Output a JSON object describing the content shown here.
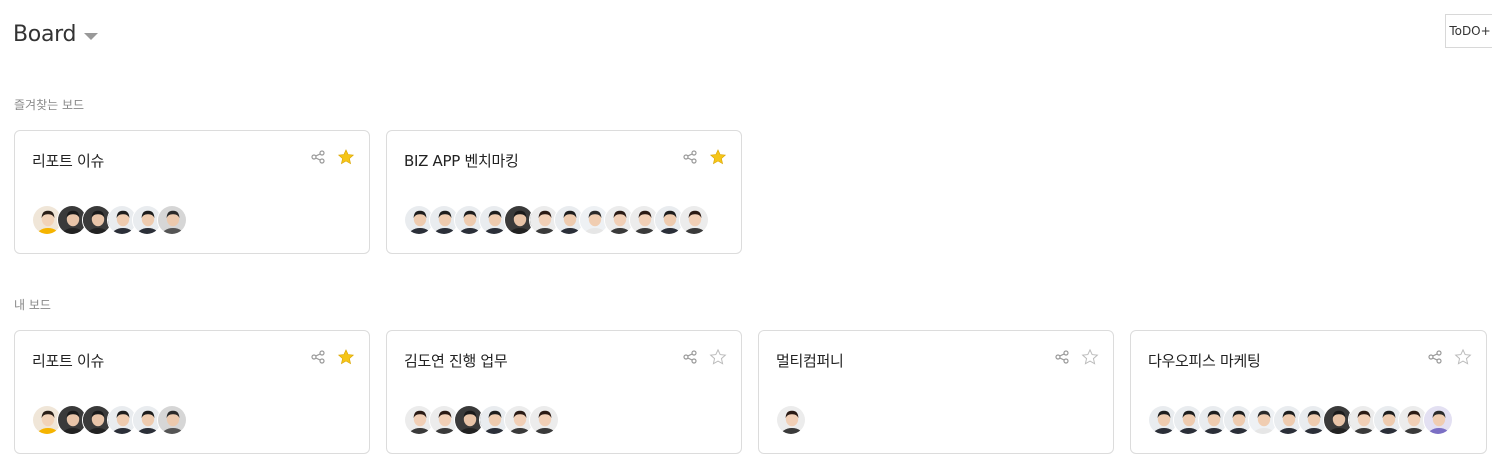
{
  "header": {
    "title": "Board",
    "todo_label": "ToDO+"
  },
  "sections": {
    "favorites_label": "즐겨찾는 보드",
    "my_boards_label": "내 보드"
  },
  "favorites": [
    {
      "title": "리포트 이슈",
      "starred": true,
      "avatars": [
        "yellow-shirt",
        "dark",
        "dark",
        "suit",
        "suit",
        "gray"
      ]
    },
    {
      "title": "BIZ APP 벤치마킹",
      "starred": true,
      "avatars": [
        "suit",
        "suit",
        "suit",
        "suit",
        "dark",
        "female",
        "suit",
        "white",
        "female",
        "female",
        "suit",
        "female"
      ]
    }
  ],
  "my_boards": [
    {
      "title": "리포트 이슈",
      "starred": true,
      "avatars": [
        "yellow-shirt",
        "dark",
        "dark",
        "suit",
        "suit",
        "gray"
      ]
    },
    {
      "title": "김도연 진행 업무",
      "starred": false,
      "avatars": [
        "female",
        "female",
        "dark",
        "suit",
        "female",
        "female"
      ]
    },
    {
      "title": "멀티컴퍼니",
      "starred": false,
      "avatars": [
        "female"
      ]
    },
    {
      "title": "다우오피스 마케팅",
      "starred": false,
      "avatars": [
        "suit",
        "suit",
        "suit",
        "suit",
        "white",
        "suit",
        "suit",
        "dark",
        "female",
        "suit",
        "female",
        "purple"
      ]
    }
  ],
  "colors": {
    "star_on": "#f5c518",
    "star_off": "#bbbbbb",
    "icon": "#999999",
    "border": "#dcdcdc"
  }
}
